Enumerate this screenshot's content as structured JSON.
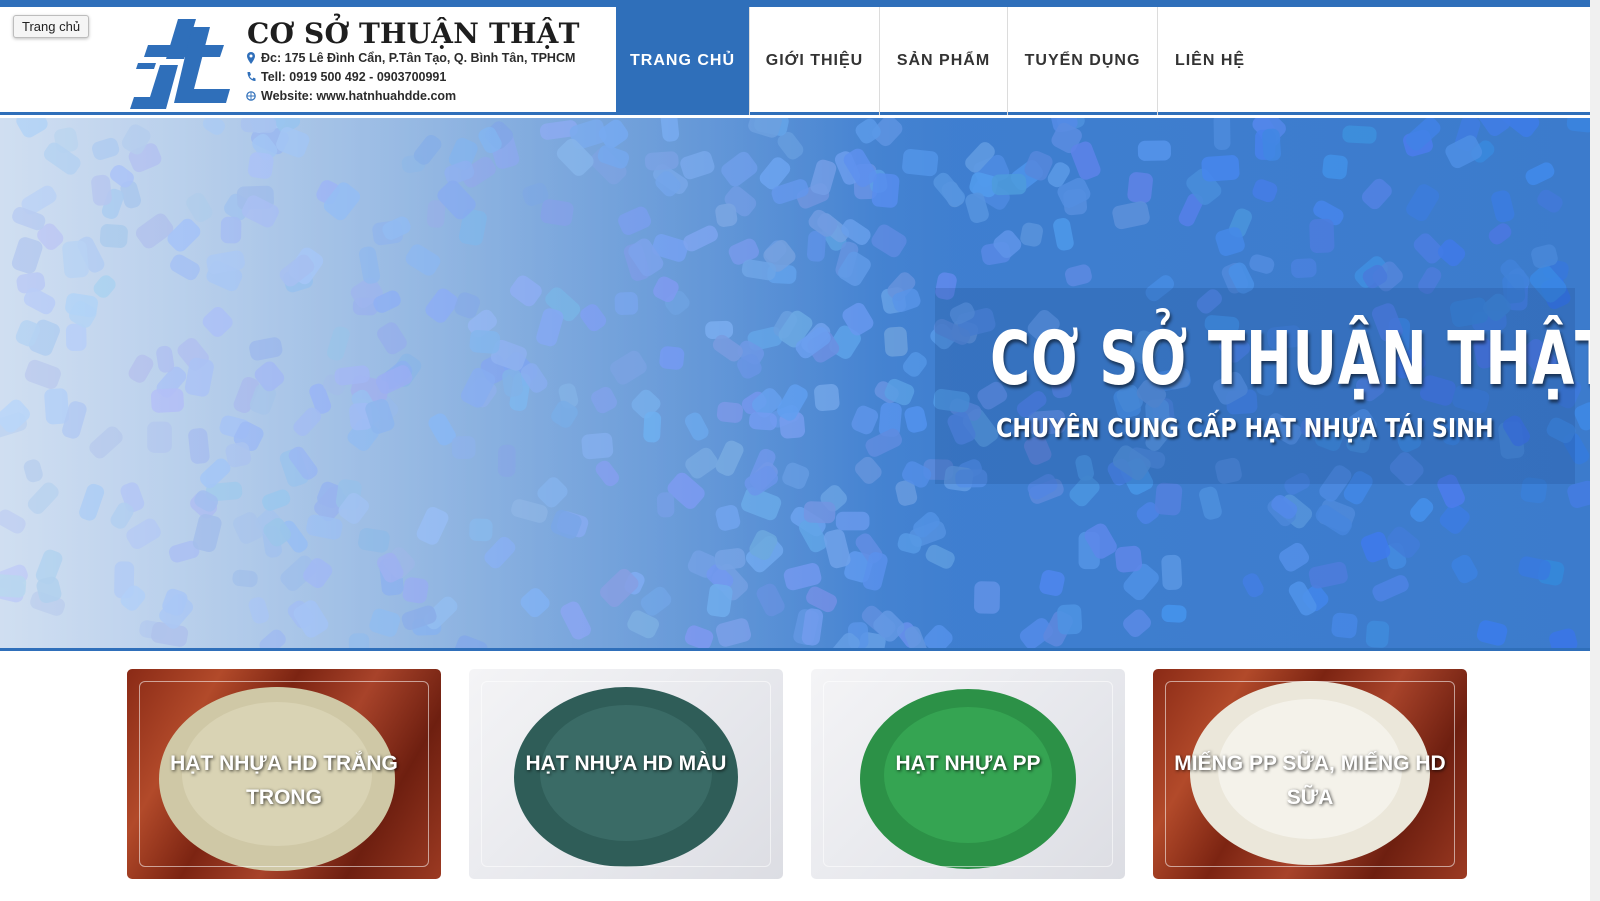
{
  "tooltip": "Trang chủ",
  "brand": {
    "name": "CƠ SỞ THUẬN THẬT",
    "address": "Đc: 175 Lê Đình Cẩn, P.Tân Tạo, Q. Bình Tân, TPHCM",
    "phone": "Tell: 0919 500 492 - 0903700991",
    "website": "Website: www.hatnhuahdde.com"
  },
  "nav": {
    "items": [
      {
        "label": "TRANG CHỦ",
        "active": true
      },
      {
        "label": "GIỚI THIỆU",
        "active": false
      },
      {
        "label": "SẢN PHẨM",
        "active": false
      },
      {
        "label": "TUYỂN DỤNG",
        "active": false
      },
      {
        "label": "LIÊN HỆ",
        "active": false
      }
    ]
  },
  "hero": {
    "title": "CƠ SỞ THUẬN THẬT",
    "subtitle": "CHUYÊN CUNG CẤP HẠT NHỰA TÁI SINH"
  },
  "products": [
    {
      "label": "HẠT NHỰA HD TRẮNG TRONG",
      "theme": "wood",
      "pile_color": "#c9c3a3"
    },
    {
      "label": "HẠT NHỰA HD MÀU",
      "theme": "light",
      "pile_color": "#2f5f5a"
    },
    {
      "label": "HẠT NHỰA PP",
      "theme": "light",
      "pile_color": "#2f9a4a"
    },
    {
      "label": "MIẾNG PP SỮA, MIẾNG HD SỮA",
      "theme": "wood",
      "pile_color": "#ece9df"
    }
  ],
  "colors": {
    "accent": "#2f6fba",
    "hero_bg": "#4a86cf"
  }
}
